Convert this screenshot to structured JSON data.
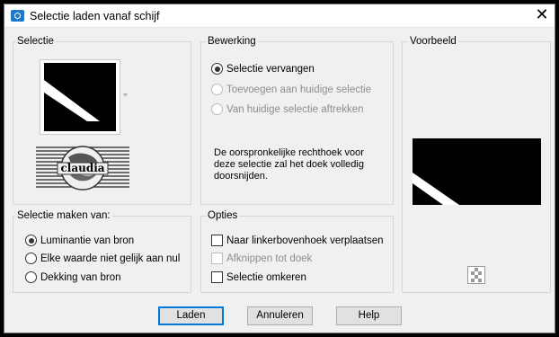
{
  "window": {
    "title": "Selectie laden vanaf schijf",
    "close_glyph": "✕"
  },
  "selectie": {
    "label": "Selectie",
    "thumb_text": "claudia"
  },
  "bewerking": {
    "label": "Bewerking",
    "options": [
      {
        "label": "Selectie vervangen",
        "selected": true,
        "disabled": false
      },
      {
        "label": "Toevoegen aan huidige selectie",
        "selected": false,
        "disabled": true
      },
      {
        "label": "Van huidige selectie aftrekken",
        "selected": false,
        "disabled": true
      }
    ],
    "description": "De oorspronkelijke rechthoek voor deze selectie zal het doek volledig doorsnijden."
  },
  "voorbeeld": {
    "label": "Voorbeeld"
  },
  "maken_van": {
    "label": "Selectie maken van:",
    "options": [
      {
        "label": "Luminantie van bron",
        "selected": true
      },
      {
        "label": "Elke waarde niet gelijk aan nul",
        "selected": false
      },
      {
        "label": "Dekking van bron",
        "selected": false
      }
    ]
  },
  "opties": {
    "label": "Opties",
    "items": [
      {
        "label": "Naar linkerbovenhoek verplaatsen",
        "checked": false,
        "disabled": false
      },
      {
        "label": "Afknippen tot doek",
        "checked": false,
        "disabled": true
      },
      {
        "label": "Selectie omkeren",
        "checked": false,
        "disabled": false
      }
    ]
  },
  "buttons": {
    "load": "Laden",
    "cancel": "Annuleren",
    "help": "Help"
  }
}
